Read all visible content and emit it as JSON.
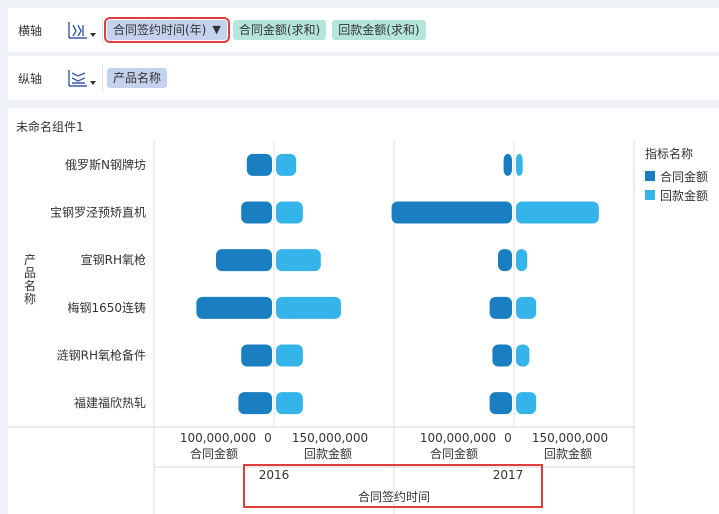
{
  "x_axis": {
    "label": "横轴",
    "fields": [
      {
        "text": "合同签约时间(年)",
        "kind": "dim",
        "selected": true,
        "filter": true
      },
      {
        "text": "合同金额(求和)",
        "kind": "measure"
      },
      {
        "text": "回款金额(求和)",
        "kind": "measure"
      }
    ]
  },
  "y_axis": {
    "label": "纵轴",
    "fields": [
      {
        "text": "产品名称",
        "kind": "dim"
      }
    ]
  },
  "component": {
    "title": "未命名组件1"
  },
  "chart_data": {
    "type": "bar",
    "orientation": "horizontal-butterfly",
    "title": "",
    "ylabel": "产品名称",
    "xlabel": "合同签约时间",
    "categories": [
      "俄罗斯N钢牌坊",
      "宝钢罗泾预矫直机",
      "宣钢RH氧枪",
      "梅钢1650连铸",
      "涟钢RH氧枪备件",
      "福建福欣热轧"
    ],
    "legend": {
      "title": "指标名称",
      "position": "right"
    },
    "colors": {
      "合同金额": "#1a7fc1",
      "回款金额": "#35b4ea"
    },
    "panels": [
      {
        "year": "2016",
        "left_axis": {
          "label": "合同金额",
          "tick": "100,000,000",
          "zero": "0",
          "max": 200000000
        },
        "right_axis": {
          "label": "回款金额",
          "tick": "150,000,000",
          "zero": "0",
          "max": 250000000
        },
        "series": [
          {
            "name": "合同金额",
            "values": [
              45000000,
              55000000,
              100000000,
              135000000,
              55000000,
              60000000
            ]
          },
          {
            "name": "回款金额",
            "values": [
              45000000,
              60000000,
              100000000,
              145000000,
              60000000,
              60000000
            ]
          }
        ]
      },
      {
        "year": "2017",
        "left_axis": {
          "label": "合同金额",
          "tick": "100,000,000",
          "zero": "0",
          "max": 200000000
        },
        "right_axis": {
          "label": "回款金额",
          "tick": "150,000,000",
          "zero": "0",
          "max": 250000000
        },
        "series": [
          {
            "name": "合同金额",
            "values": [
              15000000,
              215000000,
              25000000,
              40000000,
              35000000,
              40000000
            ]
          },
          {
            "name": "回款金额",
            "values": [
              15000000,
              185000000,
              25000000,
              45000000,
              30000000,
              45000000
            ]
          }
        ]
      }
    ]
  }
}
